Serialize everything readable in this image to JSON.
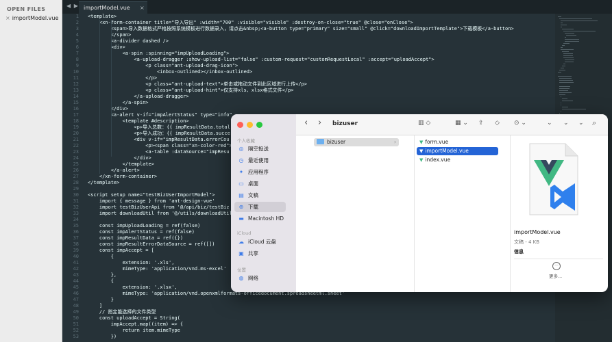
{
  "sidebar": {
    "header": "OPEN FILES",
    "open_file": "importModel.vue",
    "close_glyph": "×"
  },
  "tabbar": {
    "nav_glyph": "◀ ▶",
    "tab_label": "importModel.vue",
    "close_glyph": "×"
  },
  "editor": {
    "line_start": 1,
    "lines": [
      "<template>",
      "    <xn-form-container title=\"导入导出\" :width=\"700\" :visible=\"visible\" :destroy-on-close=\"true\" @close=\"onClose\">",
      "        <span>导入数据格式严格按照系统模板进行数据录入，请点击&nbsp;<a-button type=\"primary\" size=\"small\" @click=\"downloadImportTemplate\">下载模板</a-button>",
      "        </span>",
      "        <a-divider dashed />",
      "        <div>",
      "            <a-spin :spinning=\"impUploadLoading\">",
      "                <a-upload-dragger :show-upload-list=\"false\" :custom-request=\"customRequestLocal\" :accept=\"uploadAccept\">",
      "                    <p class=\"ant-upload-drag-icon\">",
      "                        <inbox-outlined></inbox-outlined>",
      "                    </p>",
      "                    <p class=\"ant-upload-text\">单击或拖动文件到此区域进行上传</p>",
      "                    <p class=\"ant-upload-hint\">仅支持xls、xlsx格式文件</p>",
      "                </a-upload-dragger>",
      "            </a-spin>",
      "        </div>",
      "        <a-alert v-if=\"impAlertStatus\" type=\"info\"",
      "            <template #description>",
      "                <p>导入总数：{{ impResultData.total",
      "                <p>导入成功：{{ impResultData.succe",
      "                <div v-if=\"impResultData.errorCou",
      "                    <p><span class=\"xn-color-red\">",
      "                    <a-table :dataSource=\"impResu",
      "                </div>",
      "            </template>",
      "        </a-alert>",
      "    </xn-form-container>",
      "</template>",
      "",
      "<script setup name=\"testBizUserImportModel\">",
      "    import { message } from 'ant-design-vue'",
      "    import testBizUserApi from '@/api/biz/testBiz",
      "    import downloadUtil from '@/utils/downloadUtil",
      "",
      "    const impUploadLoading = ref(false)",
      "    const impAlertStatus = ref(false)",
      "    const impResultData = ref({})",
      "    const impResultErrorDataSource = ref([])",
      "    const impAccept = [",
      "        {",
      "            extension: '.xls',",
      "            mimeType: 'application/vnd.ms-excel'",
      "        },",
      "        {",
      "            extension: '.xlsx',",
      "            mimeType: 'application/vnd.openxmlformats-officedocument.spreadsheetml.sheet'",
      "        }",
      "    ]",
      "    // 指定能选择的文件类型",
      "    const uploadAccept = String(",
      "        impAccept.map((item) => {",
      "            return item.mimeType",
      "        })"
    ]
  },
  "finder": {
    "colors": {
      "close": "#fe5f57",
      "minimize": "#febc2e",
      "zoom": "#28c840",
      "selection": "#2464d6",
      "vue_green": "#41b883",
      "vue_dark": "#35495e",
      "vscode_blue": "#2f80ed"
    },
    "toolbar": {
      "back": "‹",
      "forward": "›",
      "title": "bizuser",
      "view_glyph": "▥ ◇",
      "group_glyph": "▦ ⌄",
      "share_glyph": "⇪",
      "tag_glyph": "◇",
      "action_glyph": "⊙ ⌄",
      "dropdown1": "⌄",
      "dropdown2": "⌄",
      "search_glyph": "⌕"
    },
    "sidebar": {
      "favorites_label": "个人收藏",
      "favorites": [
        {
          "icon": "airdrop-icon",
          "glyph": "◎",
          "label": "隔空投送"
        },
        {
          "icon": "recents-icon",
          "glyph": "◷",
          "label": "最近使用"
        },
        {
          "icon": "applications-icon",
          "glyph": "✦",
          "label": "应用程序"
        },
        {
          "icon": "desktop-icon",
          "glyph": "▭",
          "label": "桌面"
        },
        {
          "icon": "documents-icon",
          "glyph": "▤",
          "label": "文稿"
        },
        {
          "icon": "downloads-icon",
          "glyph": "⊕",
          "label": "下载"
        },
        {
          "icon": "disk-icon",
          "glyph": "▬",
          "label": "Macintosh HD"
        }
      ],
      "icloud_label": "iCloud",
      "icloud": [
        {
          "icon": "icloud-icon",
          "glyph": "☁",
          "label": "iCloud 云盘"
        },
        {
          "icon": "shared-icon",
          "glyph": "▣",
          "label": "共享"
        }
      ],
      "locations_label": "位置",
      "locations": [
        {
          "icon": "network-icon",
          "glyph": "◍",
          "label": "网络"
        }
      ]
    },
    "column1": {
      "folder": "bizuser",
      "chevron": "›"
    },
    "column2": {
      "files": [
        "form.vue",
        "importModel.vue",
        "index.vue"
      ],
      "vue_glyph": "▼"
    },
    "preview": {
      "name": "importModel.vue",
      "kind": "文稿 - 4 KB",
      "info": "信息",
      "more_glyph": "···",
      "more": "更多..."
    }
  }
}
